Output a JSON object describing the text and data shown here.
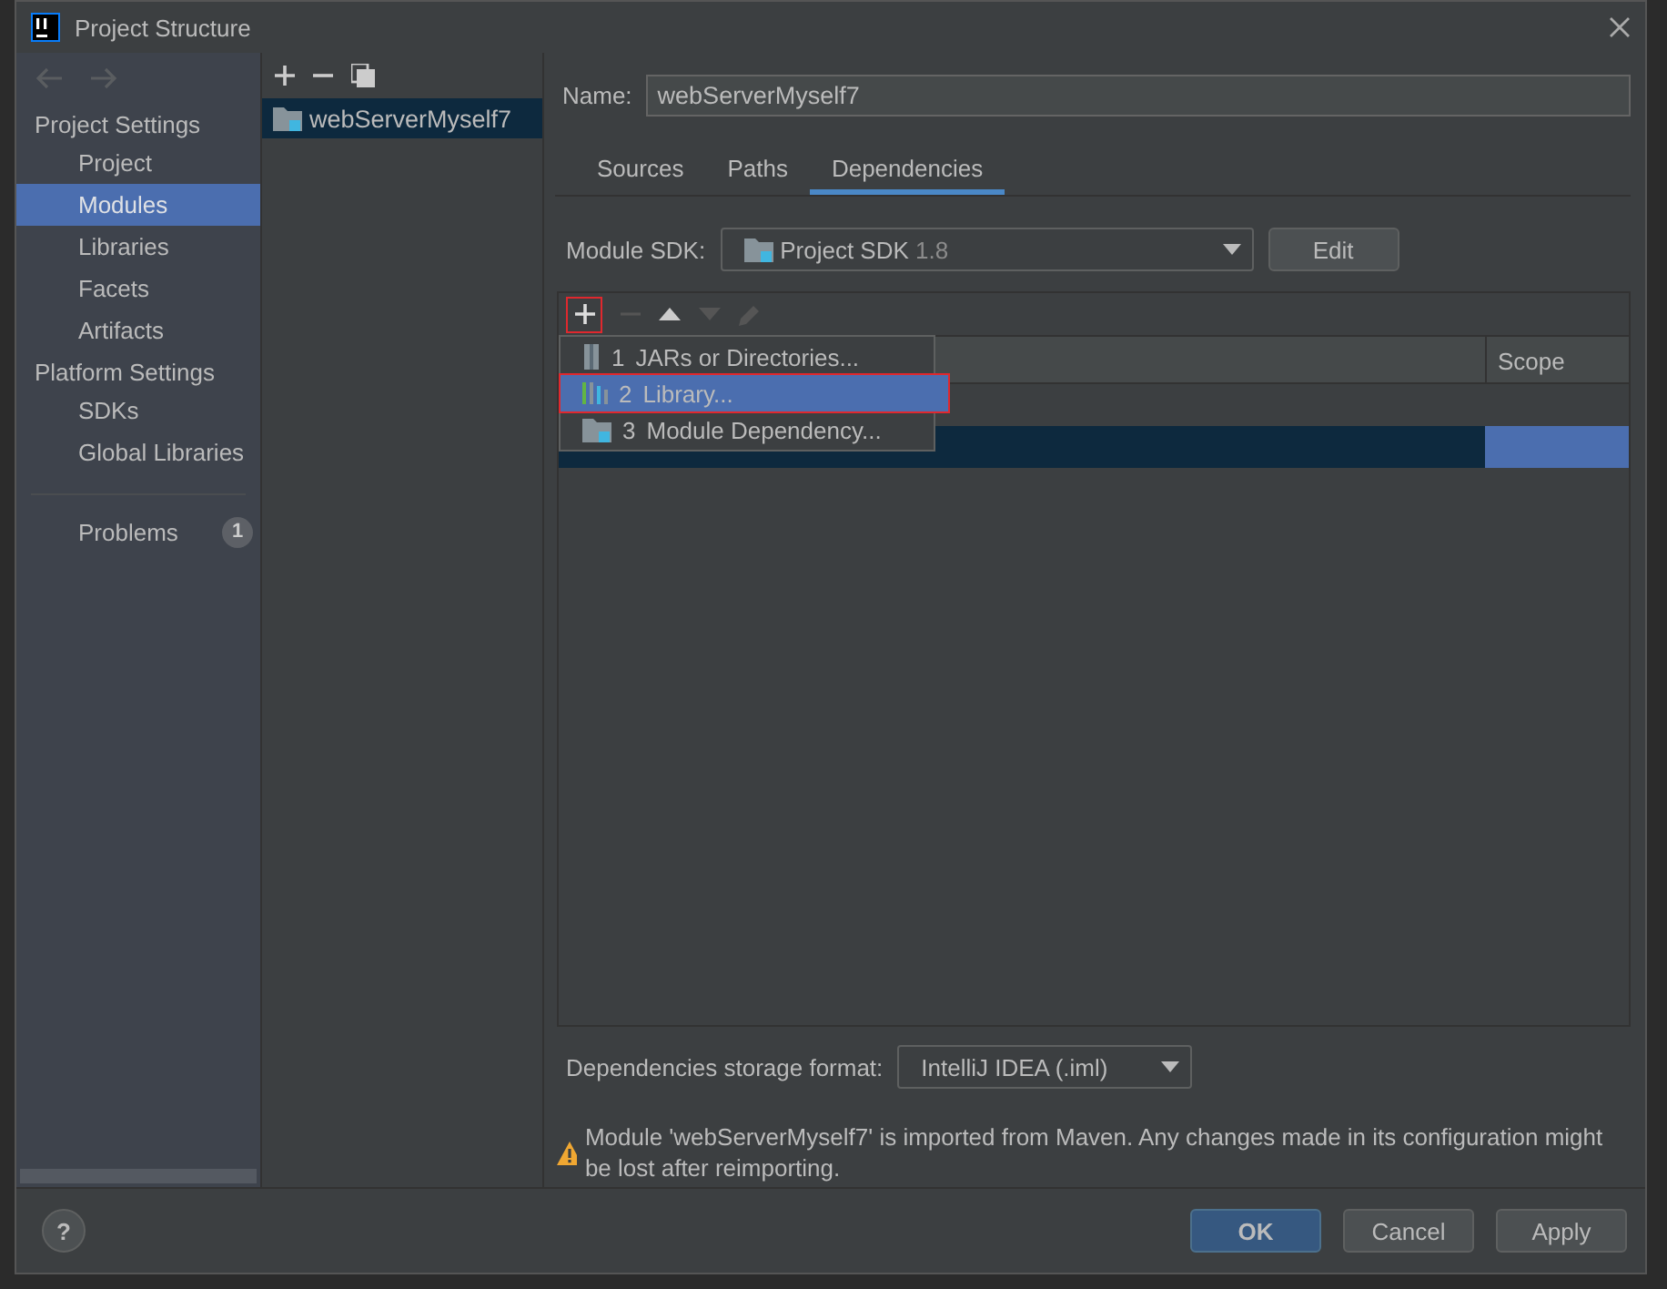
{
  "window": {
    "title": "Project Structure"
  },
  "sidebar": {
    "sections": [
      {
        "title": "Project Settings",
        "items": [
          {
            "label": "Project",
            "selected": false
          },
          {
            "label": "Modules",
            "selected": true
          },
          {
            "label": "Libraries",
            "selected": false
          },
          {
            "label": "Facets",
            "selected": false
          },
          {
            "label": "Artifacts",
            "selected": false
          }
        ]
      },
      {
        "title": "Platform Settings",
        "items": [
          {
            "label": "SDKs",
            "selected": false
          },
          {
            "label": "Global Libraries",
            "selected": false
          }
        ]
      }
    ],
    "problems": {
      "label": "Problems",
      "count": "1"
    }
  },
  "modules": [
    {
      "name": "webServerMyself7",
      "selected": true
    }
  ],
  "name_field": {
    "label": "Name:",
    "value": "webServerMyself7"
  },
  "tabs": [
    {
      "label": "Sources",
      "selected": false
    },
    {
      "label": "Paths",
      "selected": false
    },
    {
      "label": "Dependencies",
      "selected": true
    }
  ],
  "module_sdk": {
    "label": "Module SDK:",
    "value": "Project SDK",
    "version": "1.8",
    "button": "Edit"
  },
  "table": {
    "columns": [
      "Scope"
    ],
    "rows": [
      {
        "selected": false
      },
      {
        "selected": true
      }
    ]
  },
  "add_menu": [
    {
      "kind": "jar",
      "number": "1",
      "label": "JARs or Directories...",
      "selected": false
    },
    {
      "kind": "library",
      "number": "2",
      "label": "Library...",
      "selected": true
    },
    {
      "kind": "module",
      "number": "3",
      "label": "Module Dependency...",
      "selected": false
    }
  ],
  "storage": {
    "label": "Dependencies storage format:",
    "value": "IntelliJ IDEA (.iml)"
  },
  "warning": "Module 'webServerMyself7' is imported from Maven. Any changes made in its configuration might be lost after reimporting.",
  "help": "?",
  "buttons": [
    {
      "label": "OK",
      "default": true
    },
    {
      "label": "Cancel",
      "default": false
    },
    {
      "label": "Apply",
      "default": false
    }
  ]
}
